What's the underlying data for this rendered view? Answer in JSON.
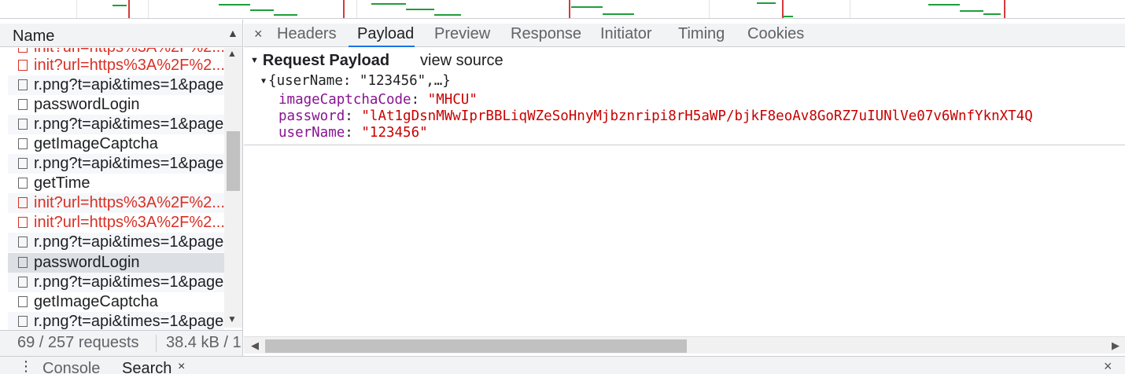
{
  "request_list": {
    "column_header": "Name",
    "rows": [
      {
        "name": "init?url=https%3A%2F%2...",
        "status": "error"
      },
      {
        "name": "init?url=https%3A%2F%2...",
        "status": "error"
      },
      {
        "name": "r.png?t=api&times=1&page=...",
        "status": "ok"
      },
      {
        "name": "passwordLogin",
        "status": "ok"
      },
      {
        "name": "r.png?t=api&times=1&page=...",
        "status": "ok"
      },
      {
        "name": "getImageCaptcha",
        "status": "ok"
      },
      {
        "name": "r.png?t=api&times=1&page=...",
        "status": "ok"
      },
      {
        "name": "getTime",
        "status": "ok"
      },
      {
        "name": "init?url=https%3A%2F%2...",
        "status": "error"
      },
      {
        "name": "init?url=https%3A%2F%2...",
        "status": "error"
      },
      {
        "name": "r.png?t=api&times=1&page=...",
        "status": "ok"
      },
      {
        "name": "passwordLogin",
        "status": "selected"
      },
      {
        "name": "r.png?t=api&times=1&page=...",
        "status": "ok"
      },
      {
        "name": "getImageCaptcha",
        "status": "ok"
      },
      {
        "name": "r.png?t=api&times=1&page=...",
        "status": "ok"
      }
    ],
    "status": {
      "requests": "69 / 257 requests",
      "transferred": "38.4 kB / 1"
    }
  },
  "detail_tabs": {
    "close": "×",
    "items": [
      "Headers",
      "Payload",
      "Preview",
      "Response",
      "Initiator",
      "Timing",
      "Cookies"
    ],
    "active": "Payload"
  },
  "payload": {
    "section_title": "Request Payload",
    "view_source": "view source",
    "summary": "{userName: \"123456\",…}",
    "properties": [
      {
        "key": "imageCaptchaCode",
        "value": "\"MHCU\""
      },
      {
        "key": "password",
        "value": "\"lAt1gDsnMWwIprBBLiqWZeSoHnyMjbznripi8rH5aWP/bjkF8eoAv8GoRZ7uIUNlVe07v6WnfYknXT4Q"
      },
      {
        "key": "userName",
        "value": "\"123456\""
      }
    ]
  },
  "drawer": {
    "tabs": [
      "Console",
      "Search"
    ],
    "close": "×"
  },
  "colors": {
    "error_text": "#d93025",
    "accent": "#1a73e8",
    "property_key": "#881391",
    "property_value": "#c80000"
  }
}
